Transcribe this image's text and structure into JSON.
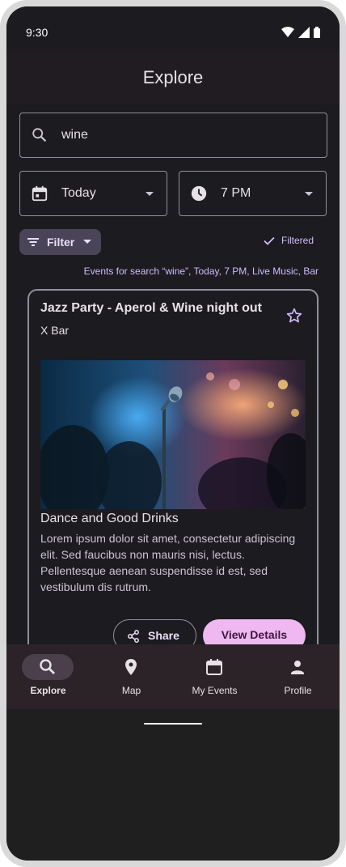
{
  "status": {
    "time": "9:30"
  },
  "appbar": {
    "title": "Explore"
  },
  "search": {
    "value": "wine",
    "placeholder": "Search"
  },
  "filters": {
    "date_value": "Today",
    "time_value": "7 PM",
    "filter_label": "Filter",
    "filtered_label": "Filtered",
    "summary": "Events for search “wine”, Today, 7 PM, Live Music, Bar"
  },
  "event": {
    "title": "Jazz Party - Aperol & Wine night out",
    "venue": "X Bar",
    "headline": "Dance and Good Drinks",
    "description": "Lorem ipsum dolor sit amet, consectetur adipiscing elit. Sed faucibus non mauris nisi, lectus. Pellentesque aenean suspendisse id est, sed vestibulum dis rutrum.",
    "share_label": "Share",
    "view_label": "View Details",
    "image_icon": "microphone-photo"
  },
  "nav": {
    "items": [
      {
        "label": "Explore",
        "icon": "search-icon"
      },
      {
        "label": "Map",
        "icon": "location-icon"
      },
      {
        "label": "My Events",
        "icon": "calendar-icon"
      },
      {
        "label": "Profile",
        "icon": "person-icon"
      }
    ],
    "active": "Explore"
  },
  "colors": {
    "background": "#1c1b1f",
    "accent": "#d0bcff",
    "primary_button": "#efb8f0",
    "chip": "#4a4458",
    "navbar": "#2c2329"
  }
}
